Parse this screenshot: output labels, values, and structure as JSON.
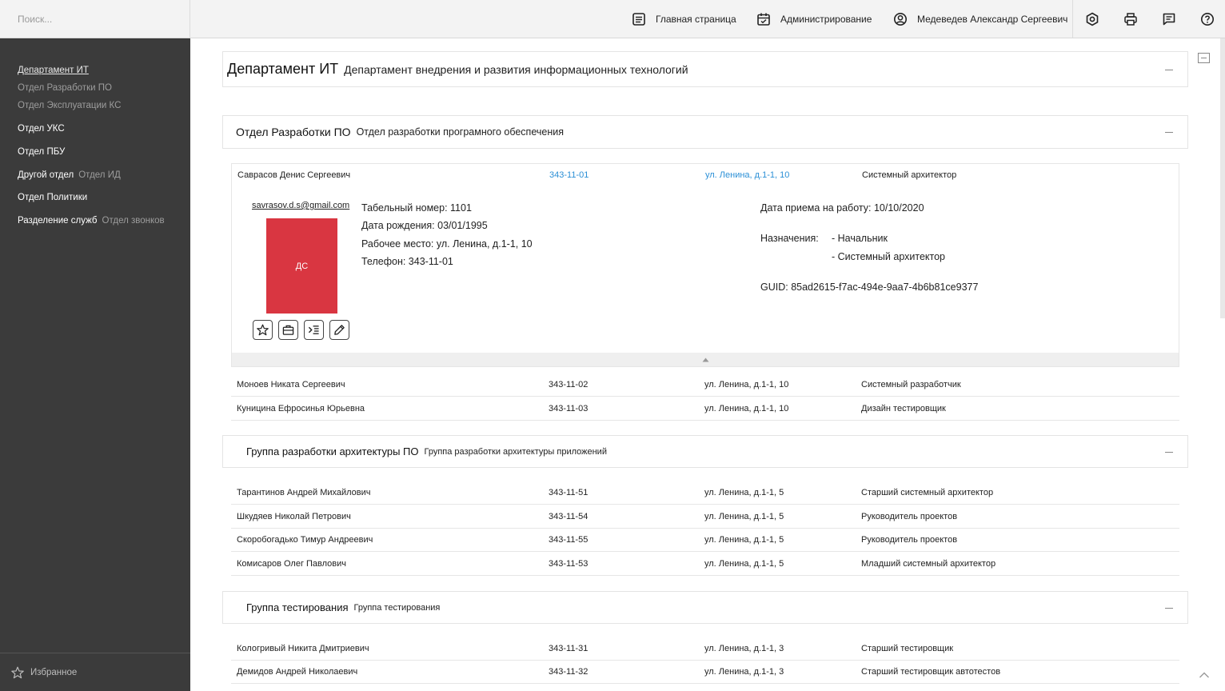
{
  "search": {
    "placeholder": "Поиск..."
  },
  "header": {
    "home_label": "Главная страница",
    "admin_label": "Администрирование",
    "user_name": "Медеведев Александр Сергеевич"
  },
  "sidebar": {
    "items": [
      {
        "label": "Департамент ИТ",
        "sub": ""
      },
      {
        "label": "Отдел Разработки ПО",
        "sub": ""
      },
      {
        "label": "Отдел Эксплуатации КС",
        "sub": ""
      },
      {
        "label": "Отдел УКС",
        "sub": ""
      },
      {
        "label": "Отдел ПБУ",
        "sub": ""
      },
      {
        "label": "Другой отдел",
        "sub": "Отдел ИД"
      },
      {
        "label": "Отдел Политики",
        "sub": ""
      },
      {
        "label": "Разделение служб",
        "sub": "Отдел звонков"
      }
    ],
    "favorites_label": "Избранное"
  },
  "department": {
    "name": "Департамент ИТ",
    "full": "Департамент внедрения и развития информационных технологий"
  },
  "section1": {
    "name": "Отдел Разработки ПО",
    "full": "Отдел разработки програмного обеспечения",
    "expanded": {
      "name": "Саврасов Денис Сергеевич",
      "phone": "343-11-01",
      "address": "ул. Ленина, д.1-1, 10",
      "position": "Системный архитектор",
      "email": "savrasov.d.s@gmail.com",
      "initials": "ДС",
      "tab_number": "Табельный номер: 1101",
      "birth": "Дата рождения: 03/01/1995",
      "workplace": "Рабочее место:  ул. Ленина, д.1-1, 10",
      "tel": "Телефон:  343-11-01",
      "hire_date": "Дата приема на работу: 10/10/2020",
      "assign_label": "Назначения:",
      "assign_1": "- Начальник",
      "assign_2": "- Системный архитектор",
      "guid": "GUID: 85ad2615-f7ac-494e-9aa7-4b6b81ce9377"
    },
    "rows": [
      {
        "name": "Моноев Никата Сергеевич",
        "phone": "343-11-02",
        "address": "ул. Ленина, д.1-1, 10",
        "position": "Системный разработчик"
      },
      {
        "name": "Куницина Ефросинья Юрьевна",
        "phone": "343-11-03",
        "address": "ул. Ленина, д.1-1, 10",
        "position": "Дизайн тестировщик"
      }
    ]
  },
  "section2": {
    "name": "Группа разработки архитектуры ПО",
    "full": "Группа разработки архитектуры приложений",
    "rows": [
      {
        "name": "Тарантинов Андрей Михайлович",
        "phone": "343-11-51",
        "address": "ул. Ленина, д.1-1, 5",
        "position": "Старший системный архитектор"
      },
      {
        "name": "Шкудяев Николай Петрович",
        "phone": "343-11-54",
        "address": "ул. Ленина, д.1-1, 5",
        "position": "Руководитель проектов"
      },
      {
        "name": "Скоробогадько Тимур Андреевич",
        "phone": "343-11-55",
        "address": "ул. Ленина, д.1-1, 5",
        "position": "Руководитель проектов"
      },
      {
        "name": "Комисаров Олег Павлович",
        "phone": "343-11-53",
        "address": "ул. Ленина, д.1-1, 5",
        "position": "Младший системный архитектор"
      }
    ]
  },
  "section3": {
    "name": "Группа тестирования",
    "full": "Группа тестирования",
    "rows": [
      {
        "name": "Кологривый Никита Дмитриевич",
        "phone": "343-11-31",
        "address": "ул. Ленина, д.1-1, 3",
        "position": "Старший тестировщик"
      },
      {
        "name": "Демидов Андрей Николаевич",
        "phone": "343-11-32",
        "address": "ул. Ленина, д.1-1, 3",
        "position": "Старший тестировщик автотестов"
      }
    ]
  },
  "colors": {
    "sidebar_bg": "#3b3b3b",
    "avatar_bg": "#d93641",
    "link": "#2a8fd6"
  }
}
